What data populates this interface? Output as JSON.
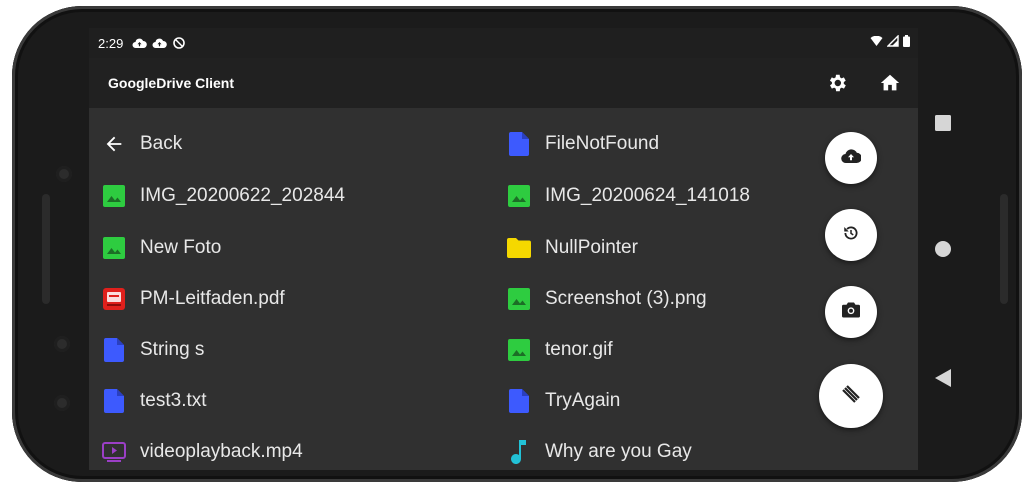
{
  "status_bar": {
    "time": "2:29",
    "left_icons": [
      "cloud-upload-icon",
      "cloud-upload-icon",
      "no-sync-icon"
    ],
    "right_icons": [
      "wifi-icon",
      "signal-icon",
      "battery-icon"
    ]
  },
  "app_bar": {
    "title": "GoogleDrive Client",
    "actions": [
      "settings-icon",
      "home-icon"
    ]
  },
  "files": [
    {
      "name": "Back",
      "icon": "arrow-back-icon",
      "color": "#ffffff"
    },
    {
      "name": "FileNotFound",
      "icon": "file-icon",
      "color": "#3d5afe"
    },
    {
      "name": "IMG_20200622_202844",
      "icon": "image-icon",
      "color": "#2ecc40"
    },
    {
      "name": "IMG_20200624_141018",
      "icon": "image-icon",
      "color": "#2ecc40"
    },
    {
      "name": "New Foto",
      "icon": "image-icon",
      "color": "#2ecc40"
    },
    {
      "name": "NullPointer",
      "icon": "folder-icon",
      "color": "#f5d800"
    },
    {
      "name": "PM-Leitfaden.pdf",
      "icon": "pdf-icon",
      "color": "#e0201c"
    },
    {
      "name": "Screenshot (3).png",
      "icon": "image-icon",
      "color": "#2ecc40"
    },
    {
      "name": "String s",
      "icon": "file-icon",
      "color": "#3d5afe"
    },
    {
      "name": "tenor.gif",
      "icon": "image-icon",
      "color": "#2ecc40"
    },
    {
      "name": "test3.txt",
      "icon": "file-icon",
      "color": "#3d5afe"
    },
    {
      "name": "TryAgain",
      "icon": "file-icon",
      "color": "#3d5afe"
    },
    {
      "name": "videoplayback.mp4",
      "icon": "video-icon",
      "color": "#9b3fc6"
    },
    {
      "name": "Why are you Gay",
      "icon": "music-note-icon",
      "color": "#22c1d6"
    }
  ],
  "fab_actions": [
    "cloud-upload-icon",
    "history-icon",
    "camera-icon",
    "menu-toggle-icon"
  ],
  "nav_buttons": [
    "recents-icon",
    "home-circle-icon",
    "back-triangle-icon"
  ],
  "colors": {
    "screen_background": "#303030",
    "app_bar": "#212121",
    "status_bar": "#1f1f1f",
    "fab": "#ffffff"
  }
}
